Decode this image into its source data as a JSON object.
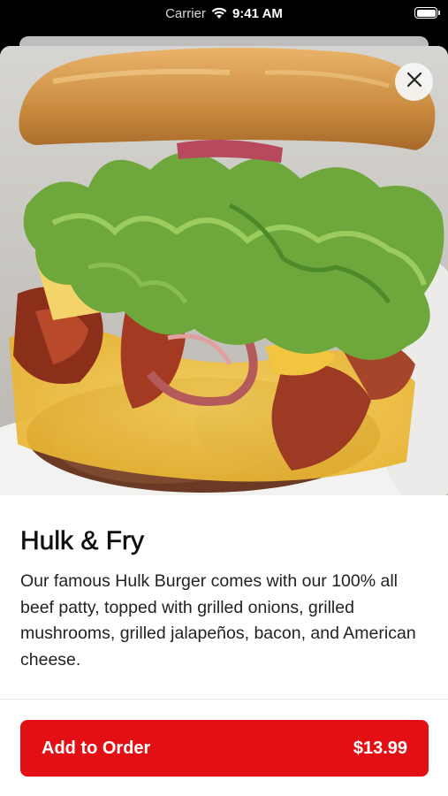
{
  "status_bar": {
    "carrier": "Carrier",
    "time": "9:41 AM",
    "wifi_icon": "wifi-icon",
    "battery_icon": "battery-icon"
  },
  "hero_image": {
    "subject": "burger with lettuce, bacon, grilled onions and melted cheese"
  },
  "close_icon": "close-icon",
  "item": {
    "title": "Hulk & Fry",
    "description": "Our famous Hulk Burger comes with our 100% all beef patty, topped with grilled onions, grilled mushrooms, grilled jalapeños, bacon, and American cheese."
  },
  "order_button": {
    "label": "Add to Order",
    "price": "$13.99"
  },
  "colors": {
    "accent": "#e21015",
    "text": "#111111",
    "background": "#ffffff"
  }
}
